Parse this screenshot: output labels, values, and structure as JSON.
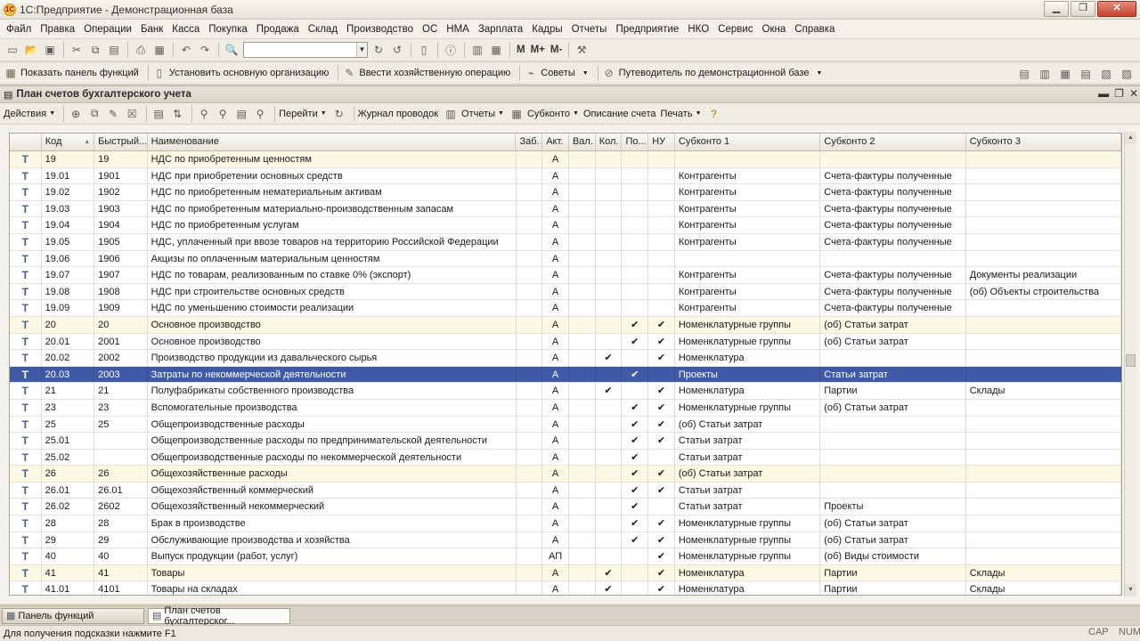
{
  "window": {
    "title": "1С:Предприятие - Демонстрационная база"
  },
  "menu": [
    "Файл",
    "Правка",
    "Операции",
    "Банк",
    "Касса",
    "Покупка",
    "Продажа",
    "Склад",
    "Производство",
    "ОС",
    "НМА",
    "Зарплата",
    "Кадры",
    "Отчеты",
    "Предприятие",
    "НКО",
    "Сервис",
    "Окна",
    "Справка"
  ],
  "toolbar1": {
    "m": "M",
    "m_plus": "M+",
    "m_minus": "M-"
  },
  "toolbar2": {
    "show_panel": "Показать панель функций",
    "set_org": "Установить основную организацию",
    "enter_op": "Ввести хозяйственную операцию",
    "tips": "Советы",
    "guide": "Путеводитель по демонстрационной базе"
  },
  "doc": {
    "title": "План счетов бухгалтерского учета",
    "actions": "Действия",
    "goto": "Перейти",
    "journal": "Журнал проводок",
    "reports": "Отчеты",
    "subkonto": "Субконто",
    "description": "Описание счета",
    "print": "Печать"
  },
  "columns": [
    "",
    "Код",
    "Быстрый...",
    "Наименование",
    "Заб.",
    "Акт.",
    "Вал.",
    "Кол.",
    "По...",
    "НУ",
    "Субконто 1",
    "Субконто 2",
    "Субконто 3"
  ],
  "rows": [
    {
      "icon": "Т",
      "code": "19",
      "quick": "19",
      "name": "НДС по приобретенным ценностям",
      "zab": "",
      "akt": "А",
      "val": "",
      "kol": "",
      "po": "",
      "nu": "",
      "s1": "",
      "s2": "",
      "s3": "",
      "yellow": true
    },
    {
      "icon": "Т",
      "code": "19.01",
      "quick": "1901",
      "name": "НДС при приобретении основных средств",
      "zab": "",
      "akt": "А",
      "val": "",
      "kol": "",
      "po": "",
      "nu": "",
      "s1": "Контрагенты",
      "s2": "Счета-фактуры полученные",
      "s3": ""
    },
    {
      "icon": "Т",
      "code": "19.02",
      "quick": "1902",
      "name": "НДС по приобретенным нематериальным активам",
      "zab": "",
      "akt": "А",
      "val": "",
      "kol": "",
      "po": "",
      "nu": "",
      "s1": "Контрагенты",
      "s2": "Счета-фактуры полученные",
      "s3": ""
    },
    {
      "icon": "Т",
      "code": "19.03",
      "quick": "1903",
      "name": "НДС по приобретенным материально-производственным запасам",
      "zab": "",
      "akt": "А",
      "val": "",
      "kol": "",
      "po": "",
      "nu": "",
      "s1": "Контрагенты",
      "s2": "Счета-фактуры полученные",
      "s3": ""
    },
    {
      "icon": "Т",
      "code": "19.04",
      "quick": "1904",
      "name": "НДС по приобретенным услугам",
      "zab": "",
      "akt": "А",
      "val": "",
      "kol": "",
      "po": "",
      "nu": "",
      "s1": "Контрагенты",
      "s2": "Счета-фактуры полученные",
      "s3": ""
    },
    {
      "icon": "Т",
      "code": "19.05",
      "quick": "1905",
      "name": "НДС, уплаченный при ввозе товаров на территорию Российской Федерации",
      "zab": "",
      "akt": "А",
      "val": "",
      "kol": "",
      "po": "",
      "nu": "",
      "s1": "Контрагенты",
      "s2": "Счета-фактуры полученные",
      "s3": ""
    },
    {
      "icon": "Т",
      "code": "19.06",
      "quick": "1906",
      "name": "Акцизы по оплаченным материальным ценностям",
      "zab": "",
      "akt": "А",
      "val": "",
      "kol": "",
      "po": "",
      "nu": "",
      "s1": "",
      "s2": "",
      "s3": ""
    },
    {
      "icon": "Т",
      "code": "19.07",
      "quick": "1907",
      "name": "НДС по товарам, реализованным по ставке 0% (экспорт)",
      "zab": "",
      "akt": "А",
      "val": "",
      "kol": "",
      "po": "",
      "nu": "",
      "s1": "Контрагенты",
      "s2": "Счета-фактуры полученные",
      "s3": "Документы реализации"
    },
    {
      "icon": "Т",
      "code": "19.08",
      "quick": "1908",
      "name": "НДС при строительстве основных средств",
      "zab": "",
      "akt": "А",
      "val": "",
      "kol": "",
      "po": "",
      "nu": "",
      "s1": "Контрагенты",
      "s2": "Счета-фактуры полученные",
      "s3": "(об) Объекты строительства"
    },
    {
      "icon": "Т",
      "code": "19.09",
      "quick": "1909",
      "name": "НДС по уменьшению стоимости реализации",
      "zab": "",
      "akt": "А",
      "val": "",
      "kol": "",
      "po": "",
      "nu": "",
      "s1": "Контрагенты",
      "s2": "Счета-фактуры полученные",
      "s3": ""
    },
    {
      "icon": "Т",
      "code": "20",
      "quick": "20",
      "name": "Основное производство",
      "zab": "",
      "akt": "А",
      "val": "",
      "kol": "",
      "po": "✔",
      "nu": "✔",
      "s1": "Номенклатурные группы",
      "s2": "(об) Статьи затрат",
      "s3": "",
      "yellow": true
    },
    {
      "icon": "Т",
      "code": "20.01",
      "quick": "2001",
      "name": "Основное производство",
      "zab": "",
      "akt": "А",
      "val": "",
      "kol": "",
      "po": "✔",
      "nu": "✔",
      "s1": "Номенклатурные группы",
      "s2": "(об) Статьи затрат",
      "s3": ""
    },
    {
      "icon": "Т",
      "code": "20.02",
      "quick": "2002",
      "name": "Производство продукции из давальческого сырья",
      "zab": "",
      "akt": "А",
      "val": "",
      "kol": "✔",
      "po": "",
      "nu": "✔",
      "s1": "Номенклатура",
      "s2": "",
      "s3": ""
    },
    {
      "icon": "Т",
      "code": "20.03",
      "quick": "2003",
      "name": "Затраты по некоммерческой деятельности",
      "zab": "",
      "akt": "А",
      "val": "",
      "kol": "",
      "po": "✔",
      "nu": "",
      "s1": "Проекты",
      "s2": "Статьи затрат",
      "s3": "",
      "selected": true
    },
    {
      "icon": "Т",
      "code": "21",
      "quick": "21",
      "name": "Полуфабрикаты собственного производства",
      "zab": "",
      "akt": "А",
      "val": "",
      "kol": "✔",
      "po": "",
      "nu": "✔",
      "s1": "Номенклатура",
      "s2": "Партии",
      "s3": "Склады"
    },
    {
      "icon": "Т",
      "code": "23",
      "quick": "23",
      "name": "Вспомогательные производства",
      "zab": "",
      "akt": "А",
      "val": "",
      "kol": "",
      "po": "✔",
      "nu": "✔",
      "s1": "Номенклатурные группы",
      "s2": "(об) Статьи затрат",
      "s3": ""
    },
    {
      "icon": "Т",
      "code": "25",
      "quick": "25",
      "name": "Общепроизводственные расходы",
      "zab": "",
      "akt": "А",
      "val": "",
      "kol": "",
      "po": "✔",
      "nu": "✔",
      "s1": "(об) Статьи затрат",
      "s2": "",
      "s3": ""
    },
    {
      "icon": "Т",
      "code": "25.01",
      "quick": "",
      "name": "Общепроизводственные расходы по предпринимательской деятельности",
      "zab": "",
      "akt": "А",
      "val": "",
      "kol": "",
      "po": "✔",
      "nu": "✔",
      "s1": "Статьи затрат",
      "s2": "",
      "s3": ""
    },
    {
      "icon": "Т",
      "code": "25.02",
      "quick": "",
      "name": "Общепроизводственные расходы по некоммерческой деятельности",
      "zab": "",
      "akt": "А",
      "val": "",
      "kol": "",
      "po": "✔",
      "nu": "",
      "s1": "Статьи затрат",
      "s2": "",
      "s3": ""
    },
    {
      "icon": "Т",
      "code": "26",
      "quick": "26",
      "name": "Общехозяйственные расходы",
      "zab": "",
      "akt": "А",
      "val": "",
      "kol": "",
      "po": "✔",
      "nu": "✔",
      "s1": "(об) Статьи затрат",
      "s2": "",
      "s3": "",
      "yellow": true
    },
    {
      "icon": "Т",
      "code": "26.01",
      "quick": "26.01",
      "name": "Общехозяйственный коммерческий",
      "zab": "",
      "akt": "А",
      "val": "",
      "kol": "",
      "po": "✔",
      "nu": "✔",
      "s1": "Статьи затрат",
      "s2": "",
      "s3": ""
    },
    {
      "icon": "Т",
      "code": "26.02",
      "quick": "2602",
      "name": "Общехозяйственный некоммерческий",
      "zab": "",
      "akt": "А",
      "val": "",
      "kol": "",
      "po": "✔",
      "nu": "",
      "s1": "Статьи затрат",
      "s2": "Проекты",
      "s3": ""
    },
    {
      "icon": "Т",
      "code": "28",
      "quick": "28",
      "name": "Брак в производстве",
      "zab": "",
      "akt": "А",
      "val": "",
      "kol": "",
      "po": "✔",
      "nu": "✔",
      "s1": "Номенклатурные группы",
      "s2": "(об) Статьи затрат",
      "s3": ""
    },
    {
      "icon": "Т",
      "code": "29",
      "quick": "29",
      "name": "Обслуживающие производства и хозяйства",
      "zab": "",
      "akt": "А",
      "val": "",
      "kol": "",
      "po": "✔",
      "nu": "✔",
      "s1": "Номенклатурные группы",
      "s2": "(об) Статьи затрат",
      "s3": ""
    },
    {
      "icon": "Т",
      "code": "40",
      "quick": "40",
      "name": "Выпуск продукции (работ, услуг)",
      "zab": "",
      "akt": "АП",
      "val": "",
      "kol": "",
      "po": "",
      "nu": "✔",
      "s1": "Номенклатурные группы",
      "s2": "(об) Виды стоимости",
      "s3": ""
    },
    {
      "icon": "Т",
      "code": "41",
      "quick": "41",
      "name": "Товары",
      "zab": "",
      "akt": "А",
      "val": "",
      "kol": "✔",
      "po": "",
      "nu": "✔",
      "s1": "Номенклатура",
      "s2": "Партии",
      "s3": "Склады",
      "yellow": true
    },
    {
      "icon": "Т",
      "code": "41.01",
      "quick": "4101",
      "name": "Товары на складах",
      "zab": "",
      "akt": "А",
      "val": "",
      "kol": "✔",
      "po": "",
      "nu": "✔",
      "s1": "Номенклатура",
      "s2": "Партии",
      "s3": "Склады"
    }
  ],
  "taskbar": {
    "panel": "Панель функций",
    "doc": "План счетов бухгалтерског..."
  },
  "status": {
    "hint": "Для получения подсказки нажмите F1",
    "cap": "CAP",
    "num": "NUM"
  }
}
